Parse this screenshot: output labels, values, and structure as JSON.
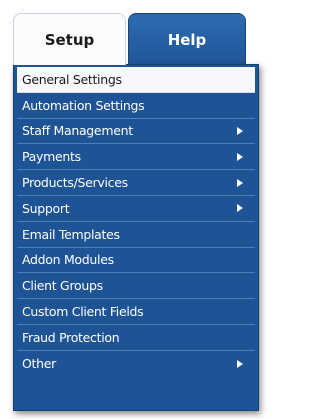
{
  "tabs": [
    {
      "label": "Setup",
      "active": true
    },
    {
      "label": "Help",
      "active": false
    }
  ],
  "menu": {
    "items": [
      {
        "label": "General Settings",
        "has_submenu": false,
        "highlighted": true
      },
      {
        "label": "Automation Settings",
        "has_submenu": false
      },
      {
        "label": "Staff Management",
        "has_submenu": true
      },
      {
        "label": "Payments",
        "has_submenu": true
      },
      {
        "label": "Products/Services",
        "has_submenu": true
      },
      {
        "label": "Support",
        "has_submenu": true
      },
      {
        "label": "Email Templates",
        "has_submenu": false
      },
      {
        "label": "Addon Modules",
        "has_submenu": false
      },
      {
        "label": "Client Groups",
        "has_submenu": false
      },
      {
        "label": "Custom Client Fields",
        "has_submenu": false
      },
      {
        "label": "Fraud Protection",
        "has_submenu": false
      },
      {
        "label": "Other",
        "has_submenu": true
      }
    ]
  },
  "colors": {
    "menu_bg": "#1e5395",
    "help_tab_bg": "#2a65aa",
    "active_item_bg": "#f6f8fb"
  },
  "icons": {
    "submenu": "arrow-right-icon"
  }
}
